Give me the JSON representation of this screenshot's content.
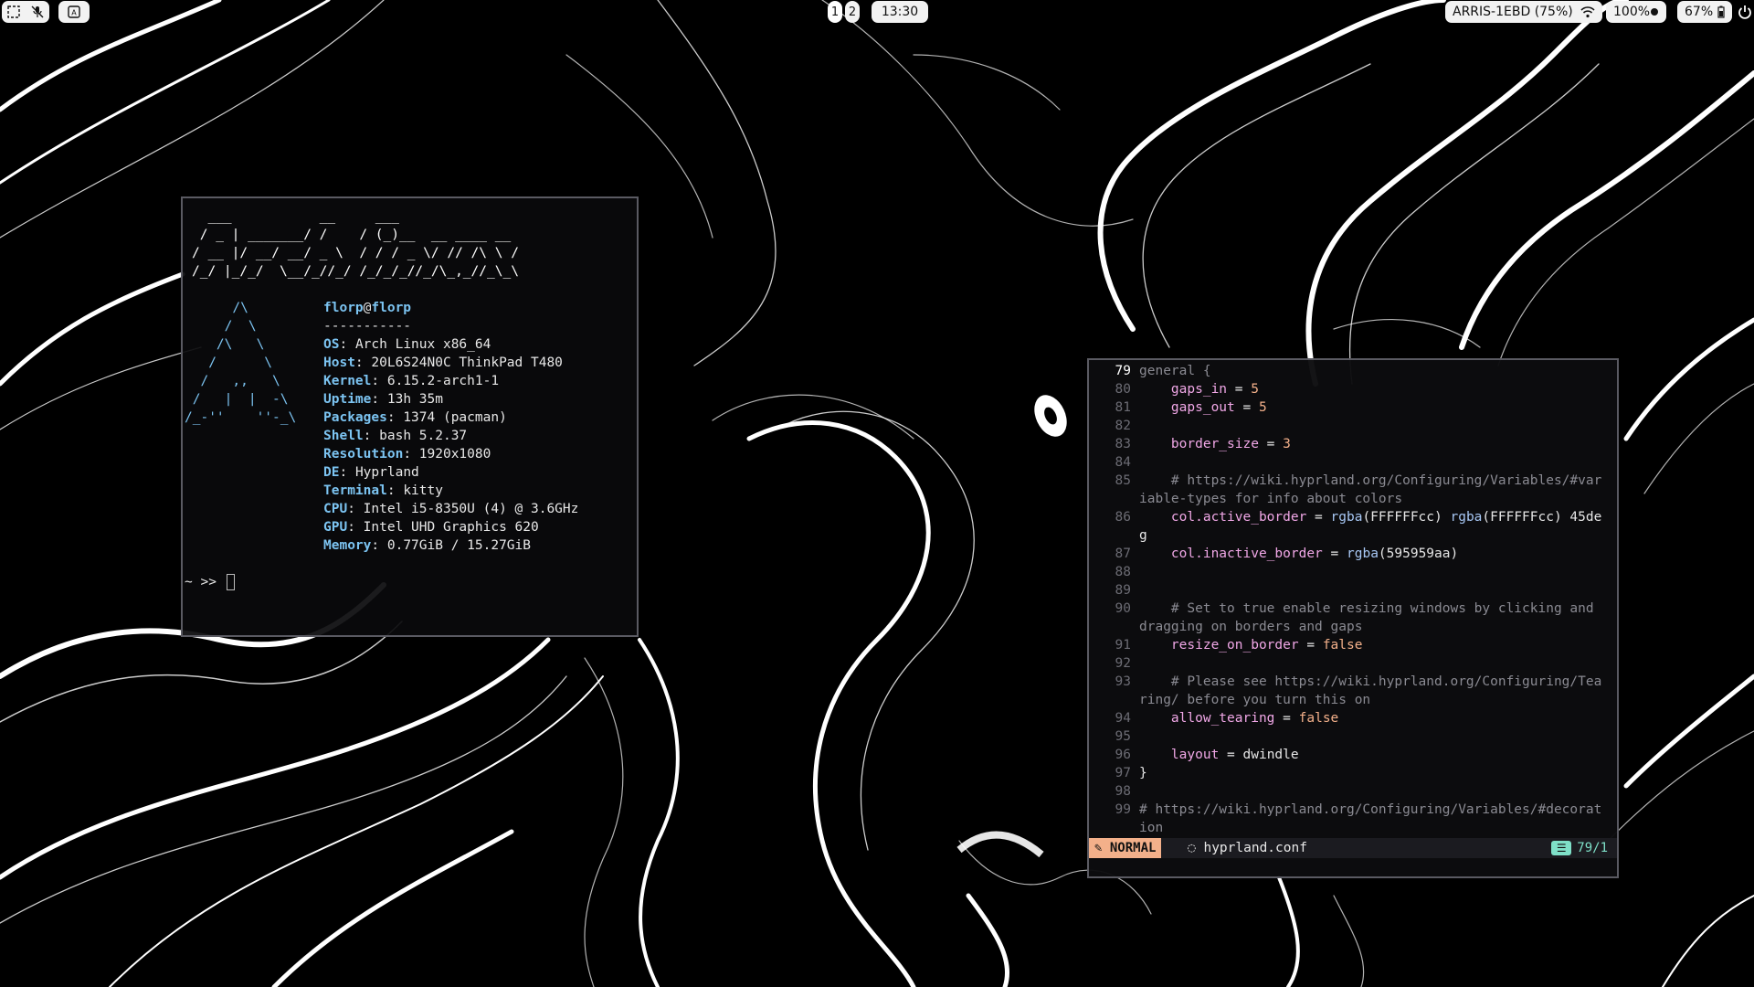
{
  "topbar": {
    "left_icons": [
      "screenshot-icon",
      "mic-muted-icon",
      "keyboard-layout-icon"
    ],
    "workspaces": [
      "1",
      "2"
    ],
    "clock": "13:30",
    "wifi": "ARRIS-1EBD (75%)",
    "volume": "100%",
    "battery": "67%"
  },
  "terminal": {
    "ascii_art": "  ___           __     ___\n / _ | _______/ /    / (_)__  __ ____ __\n/ __ |/ __/ __/ _ \\  / / / _ \\/ // /\\ \\ /\n/_/ |_/_/  \\__/_//_/ /_/_/_//_/\\_,_//_\\_\\",
    "logo": "      /\\\n     /  \\\n    /\\   \\\n   /      \\\n  /   ,,   \\\n /   |  |  -\\\n/_-''    ''-_\\",
    "user": "florp",
    "at": "@",
    "host": "florp",
    "separator": "-----------",
    "info": [
      {
        "key": "OS",
        "value": "Arch Linux x86_64"
      },
      {
        "key": "Host",
        "value": "20L6S24N0C ThinkPad T480"
      },
      {
        "key": "Kernel",
        "value": "6.15.2-arch1-1"
      },
      {
        "key": "Uptime",
        "value": "13h 35m"
      },
      {
        "key": "Packages",
        "value": "1374 (pacman)"
      },
      {
        "key": "Shell",
        "value": "bash 5.2.37"
      },
      {
        "key": "Resolution",
        "value": "1920x1080"
      },
      {
        "key": "DE",
        "value": "Hyprland"
      },
      {
        "key": "Terminal",
        "value": "kitty"
      },
      {
        "key": "CPU",
        "value": "Intel i5-8350U (4) @ 3.6GHz"
      },
      {
        "key": "GPU",
        "value": "Intel UHD Graphics 620"
      },
      {
        "key": "Memory",
        "value": "0.77GiB / 15.27GiB"
      }
    ],
    "prompt": "~ >> "
  },
  "editor": {
    "lines": [
      {
        "num": "79",
        "text": "general {"
      },
      {
        "num": "80",
        "text": "    gaps_in = 5"
      },
      {
        "num": "81",
        "text": "    gaps_out = 5"
      },
      {
        "num": "82",
        "text": ""
      },
      {
        "num": "83",
        "text": "    border_size = 3"
      },
      {
        "num": "84",
        "text": ""
      },
      {
        "num": "85",
        "text": "    # https://wiki.hyprland.org/Configuring/Variables/#var"
      },
      {
        "num": "",
        "text": "iable-types for info about colors"
      },
      {
        "num": "86",
        "text": "    col.active_border = rgba(FFFFFFcc) rgba(FFFFFFcc) 45de"
      },
      {
        "num": "",
        "text": "g"
      },
      {
        "num": "87",
        "text": "    col.inactive_border = rgba(595959aa)"
      },
      {
        "num": "88",
        "text": ""
      },
      {
        "num": "89",
        "text": ""
      },
      {
        "num": "90",
        "text": "    # Set to true enable resizing windows by clicking and"
      },
      {
        "num": "",
        "text": "dragging on borders and gaps"
      },
      {
        "num": "91",
        "text": "    resize_on_border = false"
      },
      {
        "num": "92",
        "text": ""
      },
      {
        "num": "93",
        "text": "    # Please see https://wiki.hyprland.org/Configuring/Tea"
      },
      {
        "num": "",
        "text": "ring/ before you turn this on"
      },
      {
        "num": "94",
        "text": "    allow_tearing = false"
      },
      {
        "num": "95",
        "text": ""
      },
      {
        "num": "96",
        "text": "    layout = dwindle"
      },
      {
        "num": "97",
        "text": "}"
      },
      {
        "num": "98",
        "text": ""
      },
      {
        "num": "99",
        "text": "# https://wiki.hyprland.org/Configuring/Variables/#decorat"
      },
      {
        "num": "",
        "text": "ion"
      }
    ],
    "mode": "NORMAL",
    "filename": "hyprland.conf",
    "position": "79/1"
  }
}
